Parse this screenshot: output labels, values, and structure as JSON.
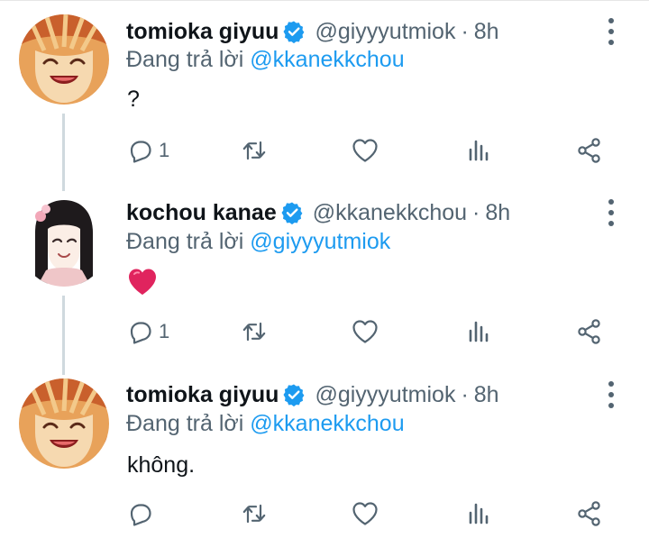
{
  "replying_prefix": "Đang trả lời",
  "colors": {
    "text": "#0f1419",
    "secondary": "#536471",
    "accent": "#1d9bf0",
    "heart": "#e0245e"
  },
  "tweets": [
    {
      "name": "tomioka giyuu",
      "handle": "@giyyyutmiok",
      "separator": "·",
      "time": "8h",
      "replying_to": "@kkanekkchou",
      "text": "?",
      "reply_count": "1",
      "avatar": "tomioka-avatar"
    },
    {
      "name": "kochou kanae",
      "handle": "@kkanekkchou",
      "separator": "·",
      "time": "8h",
      "replying_to": "@giyyyutmiok",
      "text": "",
      "emoji": "red-heart-emoji",
      "reply_count": "1",
      "avatar": "kanae-avatar"
    },
    {
      "name": "tomioka giyuu",
      "handle": "@giyyyutmiok",
      "separator": "·",
      "time": "8h",
      "replying_to": "@kkanekkchou",
      "text": "không.",
      "reply_count": "",
      "avatar": "tomioka-avatar"
    }
  ]
}
